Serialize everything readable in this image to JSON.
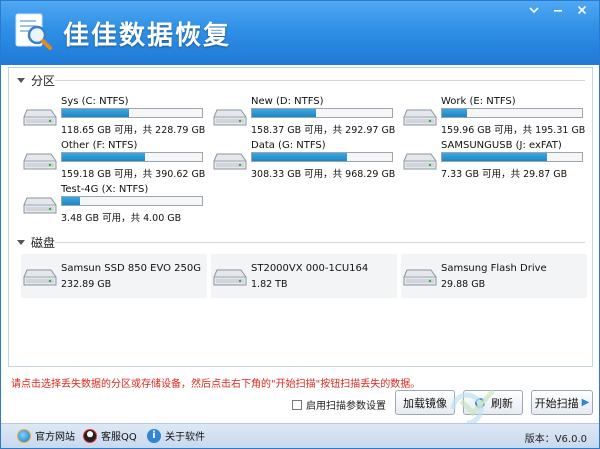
{
  "window": {
    "title": "佳佳数据恢复",
    "menu_icon": "menu-icon",
    "minimize_icon": "minimize-icon",
    "close_icon": "close-icon"
  },
  "sections": {
    "partitions_label": "分区",
    "disks_label": "磁盘"
  },
  "partitions": [
    {
      "name": "Sys (C: NTFS)",
      "info": "118.65 GB 可用，共 228.79 GB",
      "used_fraction": 0.48
    },
    {
      "name": "New (D: NTFS)",
      "info": "158.37 GB 可用，共 292.97 GB",
      "used_fraction": 0.46
    },
    {
      "name": "Work (E: NTFS)",
      "info": "159.96 GB 可用，共 195.31 GB",
      "used_fraction": 0.18
    },
    {
      "name": "Other (F: NTFS)",
      "info": "159.18 GB 可用，共 390.62 GB",
      "used_fraction": 0.59
    },
    {
      "name": "Data (G: NTFS)",
      "info": "308.33 GB 可用，共 968.29 GB",
      "used_fraction": 0.68
    },
    {
      "name": "SAMSUNGUSB (J: exFAT)",
      "info": "7.33 GB 可用，共 29.87 GB",
      "used_fraction": 0.75
    },
    {
      "name": "Test-4G (X: NTFS)",
      "info": "3.48 GB 可用，共 4.00 GB",
      "used_fraction": 0.13
    }
  ],
  "disks": [
    {
      "name": "Samsun SSD 850 EVO 250G",
      "info": "232.89 GB"
    },
    {
      "name": "ST2000VX 000-1CU164",
      "info": "1.82 TB"
    },
    {
      "name": "Samsung Flash Drive",
      "info": "29.88 GB"
    }
  ],
  "hint": "请点击选择丢失数据的分区或存储设备，然后点击右下角的\"开始扫描\"按钮扫描丢失的数据。",
  "options": {
    "scan_params_label": "启用扫描参数设置",
    "scan_params_checked": false
  },
  "buttons": {
    "load_image": "加载镜像",
    "refresh": "刷新",
    "start_scan": "开始扫描"
  },
  "footer": {
    "website": "官方网站",
    "qq": "客服QQ",
    "about": "关于软件",
    "version": "版本：V6.0.0"
  },
  "colors": {
    "titlebar": "#2f8fe6",
    "usage_bar": "#1e85c4",
    "hint_text": "#e0261d"
  }
}
